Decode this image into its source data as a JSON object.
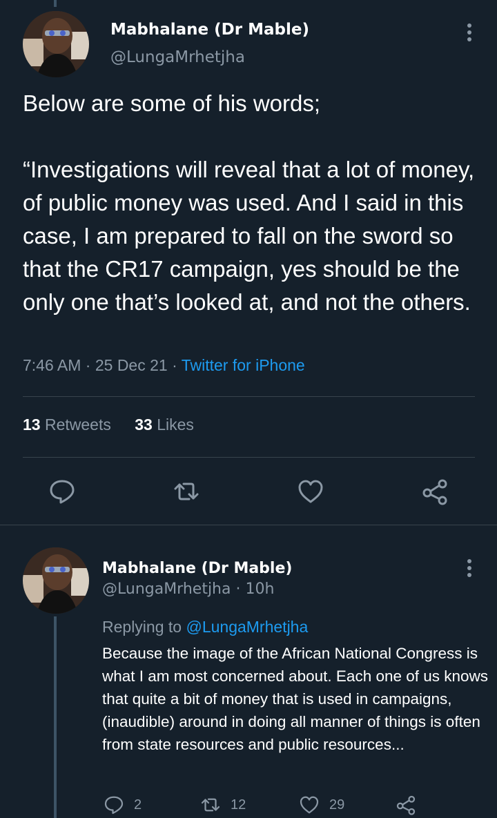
{
  "main_tweet": {
    "author": {
      "display_name": "Mabhalane (Dr Mable)",
      "handle": "@LungaMrhetjha"
    },
    "text": "Below are some of his words;\n\n“Investigations will reveal that a lot of money, of public money was used. And I said in this case, I am prepared to fall on the sword so that the CR17 campaign, yes should be the only one that’s looked at, and not the others.",
    "time": "7:46 AM",
    "sep1": " · ",
    "date": "25 Dec 21",
    "sep2": " · ",
    "source": "Twitter for iPhone",
    "retweets_count": "13",
    "retweets_label": "Retweets",
    "likes_count": "33",
    "likes_label": "Likes",
    "actions": [
      "reply-icon",
      "retweet-icon",
      "like-icon",
      "share-icon"
    ]
  },
  "reply_tweet": {
    "author": {
      "display_name": "Mabhalane (Dr Mable)",
      "handle": "@LungaMrhetjha",
      "time_sep": " · ",
      "time": "10h"
    },
    "replying_to_label": "Replying to ",
    "replying_to_handle": "@LungaMrhetjha",
    "text": "Because the image of the African National Congress is what I am most concerned about. Each one of us knows that quite a bit of money that is used in campaigns, (inaudible) around in doing all manner of things is often from state resources and public resources...",
    "reply_count": "2",
    "retweet_count": "12",
    "like_count": "29"
  },
  "colors": {
    "background": "#15202b",
    "text": "#ffffff",
    "secondary": "#8b98a5",
    "accent": "#1d9bf0",
    "divider": "#38444d"
  }
}
